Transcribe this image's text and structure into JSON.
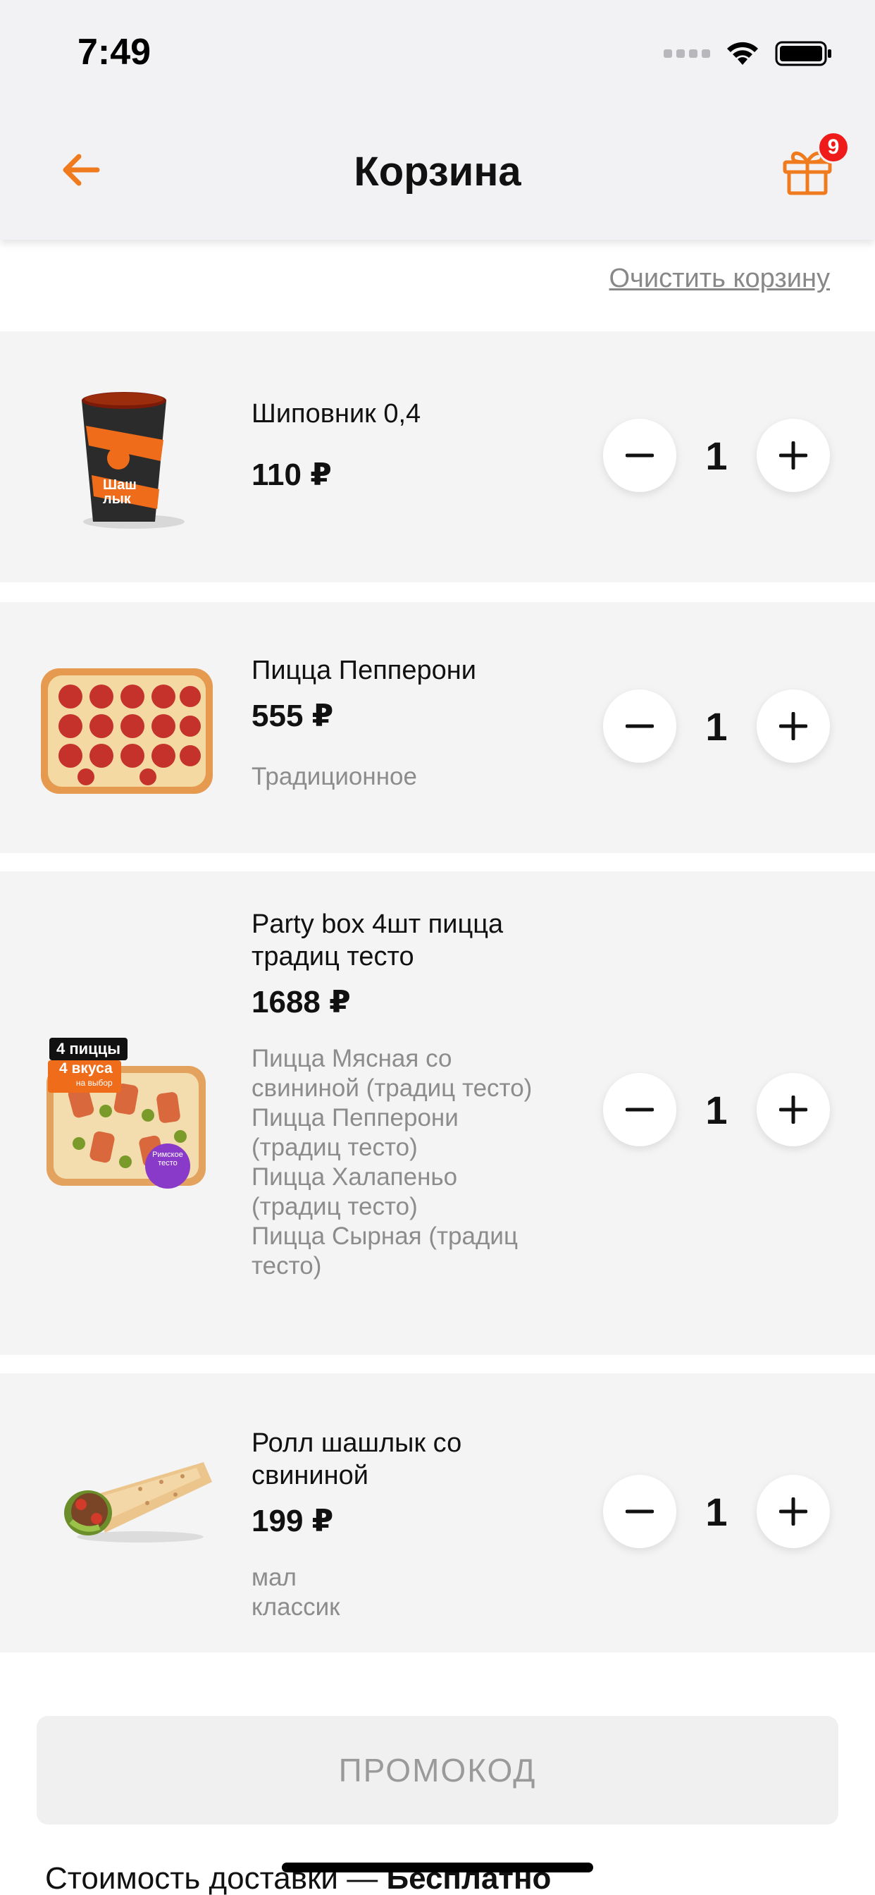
{
  "status_bar": {
    "time": "7:49"
  },
  "header": {
    "title": "Корзина",
    "gift_badge_count": "9"
  },
  "cart": {
    "clear_label": "Очистить корзину",
    "items": [
      {
        "name": "Шиповник 0,4",
        "price": "110 ₽",
        "options": [],
        "quantity": "1"
      },
      {
        "name": "Пицца Пепперони",
        "price": "555 ₽",
        "options": [
          "Традиционное"
        ],
        "quantity": "1"
      },
      {
        "name": "Party box 4шт пицца традиц тесто",
        "price": "1688 ₽",
        "options": [
          "Пицца Мясная со свининой (традиц тесто)",
          "Пицца Пепперони (традиц тесто)",
          "Пицца Халапеньо (традиц тесто)",
          "Пицца Сырная (традиц тесто)"
        ],
        "quantity": "1",
        "badge_top": "4 пиццы",
        "badge_flavours": "4 вкуса",
        "badge_flavours_note": "на выбор",
        "badge_dough": "Римское тесто"
      },
      {
        "name": "Ролл шашлык со свининой",
        "price": "199 ₽",
        "options": [
          "мал",
          "классик"
        ],
        "quantity": "1"
      }
    ]
  },
  "promo": {
    "label": "ПРОМОКОД"
  },
  "delivery": {
    "label": "Стоимость доставки — ",
    "value": "Бесплатно"
  },
  "colors": {
    "accent": "#f07b1e",
    "badge": "#ef1b1b",
    "item_bg": "#f4f4f5"
  },
  "icons": {
    "back": "arrow-left-icon",
    "gift": "gift-icon",
    "minus": "minus-icon",
    "plus": "plus-icon"
  }
}
